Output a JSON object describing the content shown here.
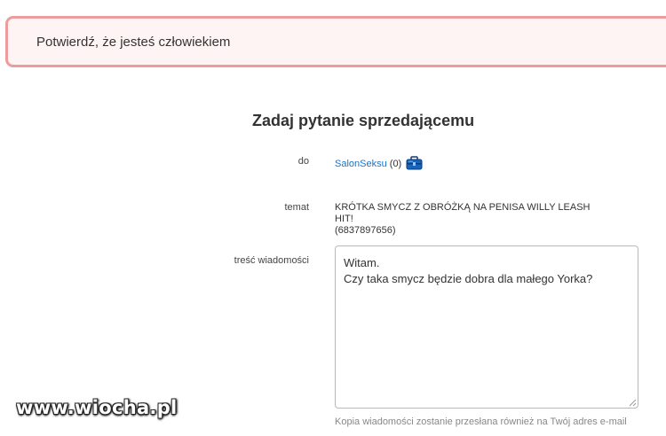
{
  "alert": {
    "text": "Potwierdź, że jesteś człowiekiem"
  },
  "form": {
    "title": "Zadaj pytanie sprzedającemu",
    "to": {
      "label": "do",
      "seller_name": "SalonSeksu",
      "seller_rating": "(0)",
      "badge_icon": "briefcase-icon"
    },
    "subject": {
      "label": "temat",
      "title": "KRÓTKA SMYCZ Z OBRÓŻKĄ NA PENISA WILLY LEASH HIT!",
      "item_id": "(6837897656)"
    },
    "message": {
      "label": "treść wiadomości",
      "value": "Witam.\nCzy taka smycz będzie dobra dla małego Yorka?"
    },
    "copy_note": "Kopia wiadomości zostanie przesłana również na Twój adres e-mail"
  },
  "watermark": {
    "text": "www.wiocha.pl"
  },
  "colors": {
    "alert_border": "#ef9a9c",
    "alert_background": "#fff4f4",
    "link": "#1a73c7",
    "badge": "#1565c0"
  }
}
